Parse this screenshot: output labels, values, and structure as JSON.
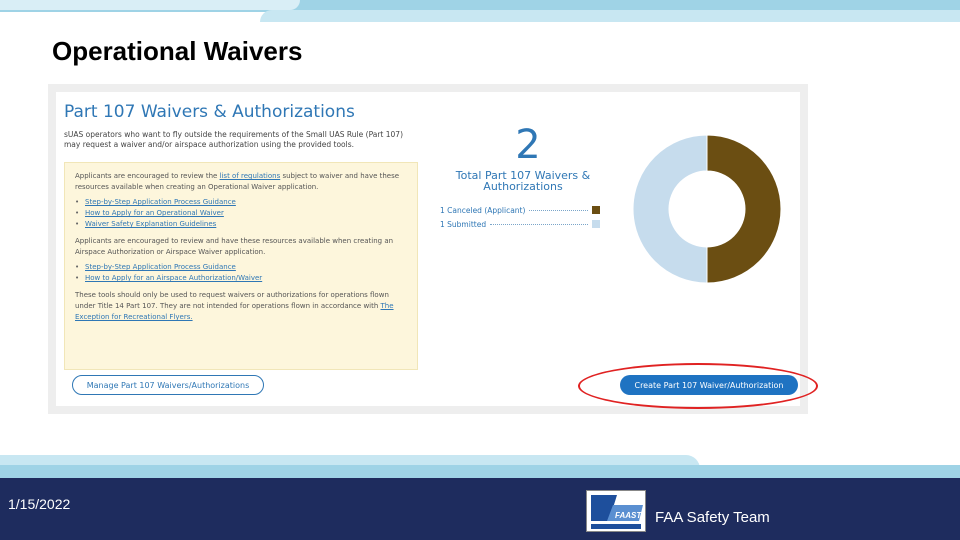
{
  "slide": {
    "title": "Operational Waivers",
    "date": "1/15/2022",
    "org": "FAA Safety Team",
    "logo_text": "FAAST"
  },
  "card": {
    "heading": "Part 107 Waivers & Authorizations",
    "intro": "sUAS operators who want to fly outside the requirements of the Small UAS Rule (Part 107) may request a waiver and/or airspace authorization using the provided tools.",
    "info": {
      "p1_before": "Applicants are encouraged to review the ",
      "p1_link": "list of regulations",
      "p1_after": " subject to waiver and have these resources available when creating an Operational Waiver application.",
      "list1": [
        "Step-by-Step Application Process Guidance",
        "How to Apply for an Operational Waiver",
        "Waiver Safety Explanation Guidelines"
      ],
      "p2": "Applicants are encouraged to review and have these resources available when creating an Airspace Authorization or Airspace Waiver application.",
      "list2": [
        "Step-by-Step Application Process Guidance",
        "How to Apply for an Airspace Authorization/Waiver"
      ],
      "p3_before": "These tools should only be used to request waivers or authorizations for operations flown under Title 14 Part 107. They are not intended for operations flown in accordance with ",
      "p3_link": "The Exception for Recreational Flyers."
    },
    "total": {
      "value": "2",
      "label": "Total Part 107 Waivers & Authorizations"
    },
    "legend": [
      {
        "label": "1 Canceled (Applicant)",
        "color": "#6b4e12",
        "count": 1
      },
      {
        "label": "1 Submitted",
        "color": "#c6dced",
        "count": 1
      }
    ],
    "buttons": {
      "manage": "Manage Part 107 Waivers/Authorizations",
      "create": "Create Part 107 Waiver/Authorization"
    }
  },
  "colors": {
    "accent": "#2f77b5",
    "primary_button": "#1f73c2",
    "highlight": "#e02222",
    "footer": "#1e2c5e"
  }
}
